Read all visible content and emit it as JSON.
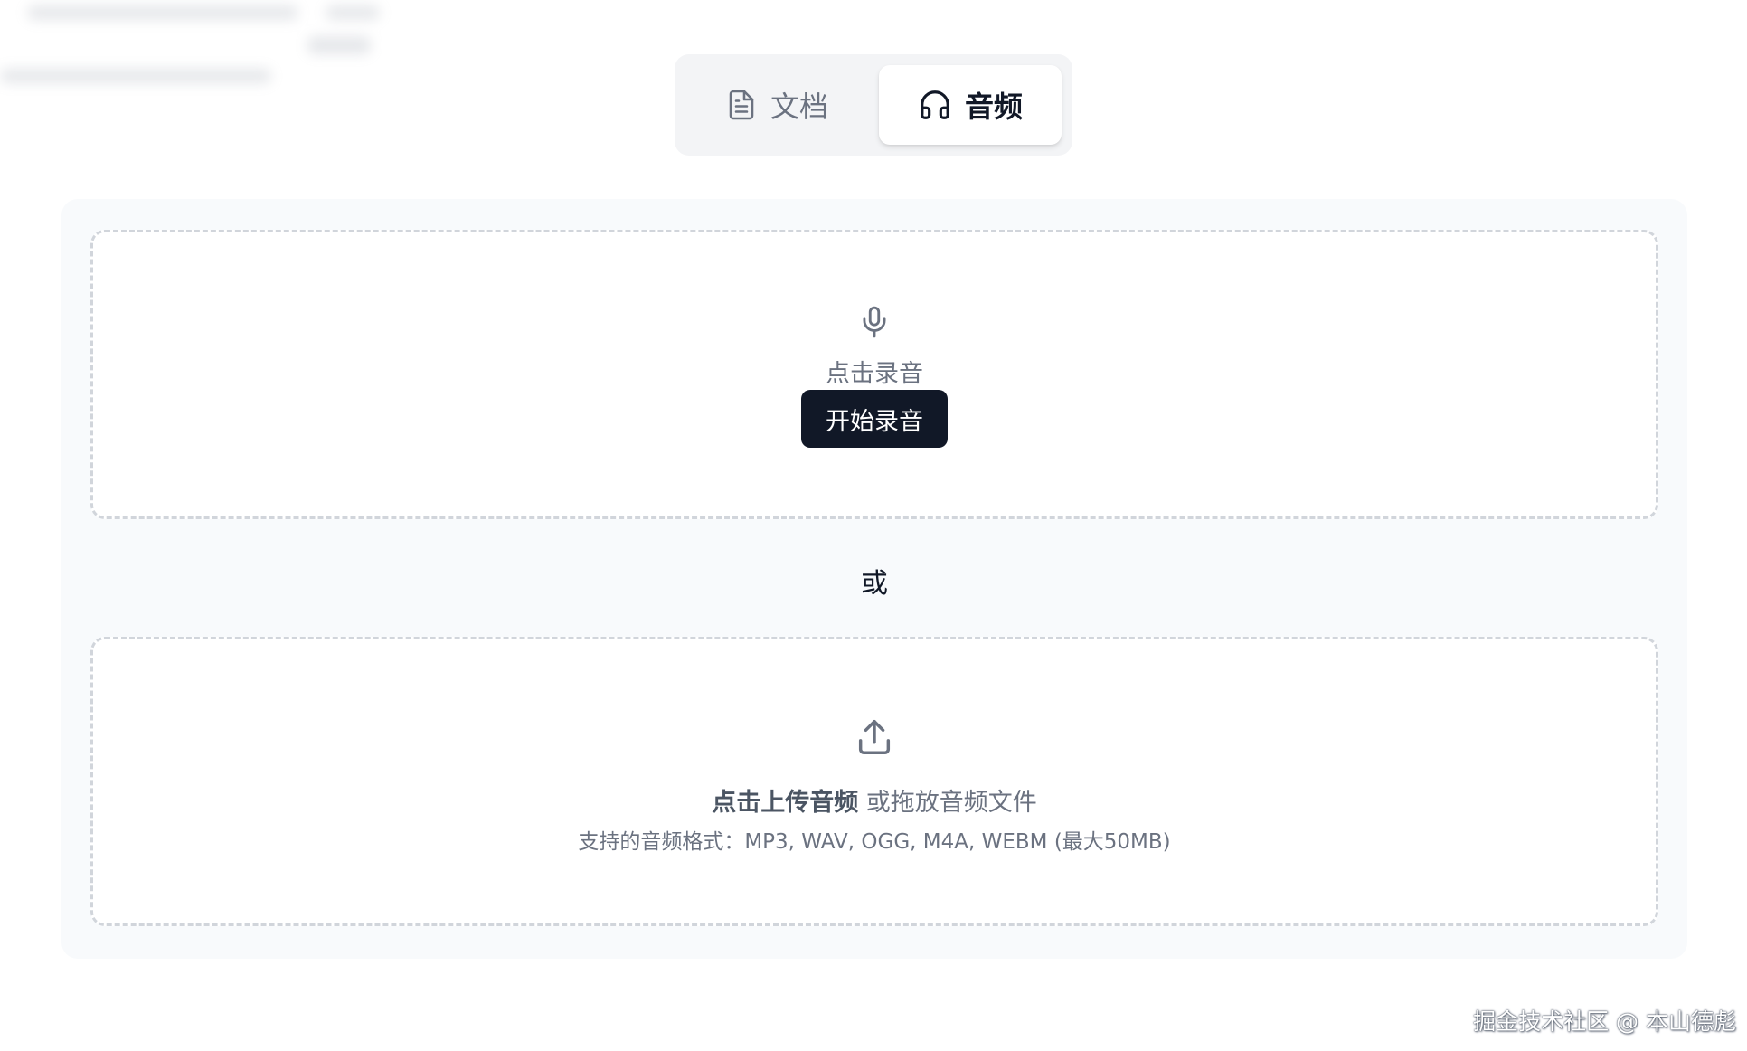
{
  "tabs": {
    "document_label": "文档",
    "document_icon": "document-icon",
    "audio_label": "音频",
    "audio_icon": "headphones-icon",
    "active": "audio"
  },
  "record": {
    "icon": "microphone-icon",
    "hint": "点击录音",
    "button_label": "开始录音"
  },
  "divider_text": "或",
  "upload": {
    "icon": "upload-icon",
    "link_text": "点击上传音频",
    "rest_text": "或拖放音频文件",
    "formats_text": "支持的音频格式：MP3, WAV, OGG, M4A, WEBM (最大50MB)"
  },
  "watermark": "掘金技术社区 @ 本山德彪",
  "colors": {
    "primary_button": "#111827",
    "panel_bg": "#f8fafc",
    "dashed_border": "#d1d5db",
    "muted_text": "#6b7280"
  }
}
